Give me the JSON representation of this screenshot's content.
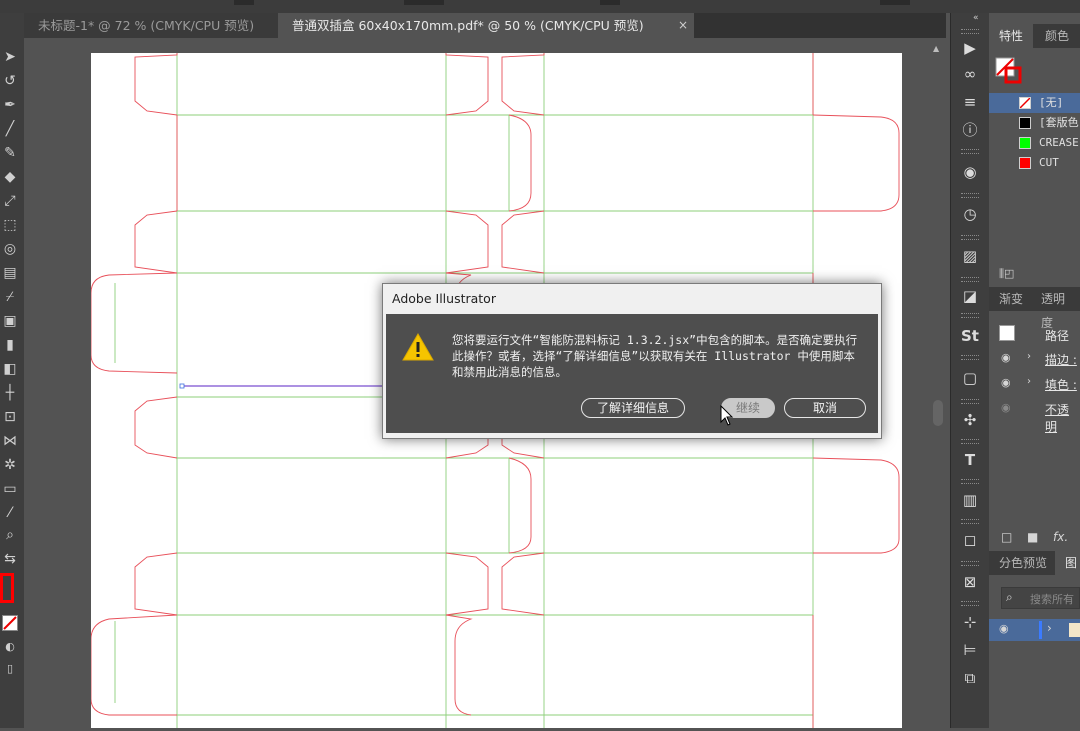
{
  "tabs": [
    {
      "label": "未标题-1* @ 72 % (CMYK/CPU 预览)",
      "close": "×"
    },
    {
      "label": "普通双插盒 60x40x170mm.pdf* @ 50 % (CMYK/CPU 预览)",
      "close": "×"
    }
  ],
  "dialog": {
    "title": "Adobe Illustrator",
    "message": "您将要运行文件“智能防混料标记 1.3.2.jsx”中包含的脚本。是否确定要执行此操作？或者，选择“了解详细信息”以获取有关在 Illustrator 中使用脚本和禁用此消息的信息。",
    "buttons": {
      "learn_more": "了解详细信息",
      "continue": "继续",
      "cancel": "取消"
    },
    "icon": "warning-icon"
  },
  "swatch_panel": {
    "tabs": [
      "特性",
      "颜色"
    ],
    "swatches": [
      {
        "name": "[无]",
        "color": "none",
        "selected": true
      },
      {
        "name": "[套版色",
        "color": "#000000",
        "selected": false
      },
      {
        "name": "CREASE",
        "color": "#00ff00",
        "selected": false
      },
      {
        "name": "CUT",
        "color": "#ff0000",
        "selected": false
      }
    ]
  },
  "appearance_panel": {
    "tabs": [
      "渐变",
      "透明度"
    ],
    "header": "路径",
    "rows": [
      {
        "label": "描边 :"
      },
      {
        "label": "填色 :"
      },
      {
        "label": "不透明"
      }
    ],
    "footer_fx": "fx."
  },
  "separations_panel": {
    "tabs": [
      "分色预览",
      "图"
    ],
    "search_placeholder": "搜索所有"
  },
  "colors": {
    "dieline_cut": "#e8505a",
    "dieline_crease": "#8ccf7a",
    "selection": "#7a4fd0",
    "fill_indicator": "#ff0000"
  },
  "icons": {
    "toolbar": [
      "selection-tool-icon",
      "direct-selection-icon",
      "pen-tool-icon",
      "line-tool-icon",
      "brush-tool-icon",
      "eraser-tool-icon",
      "scale-tool-icon",
      "free-transform-icon",
      "shape-builder-icon",
      "gradient-tool-icon",
      "eyedropper-tool-icon",
      "symbol-sprayer-icon",
      "graph-tool-icon",
      "artboard-tool-icon",
      "slice-tool-icon",
      "perspective-icon",
      "puppet-warp-icon",
      "zoom-tool-icon",
      "hand-tool-icon"
    ],
    "dock": [
      "play-icon",
      "link-icon",
      "properties-icon",
      "info-icon",
      "eye-icon",
      "clock-icon",
      "image-trace-icon",
      "asset-export-icon",
      "stock-icon",
      "swatch-icon",
      "puzzle-icon",
      "type-icon",
      "ruler-icon",
      "artboard-icon",
      "align-icon",
      "pathfinder-icon"
    ]
  }
}
